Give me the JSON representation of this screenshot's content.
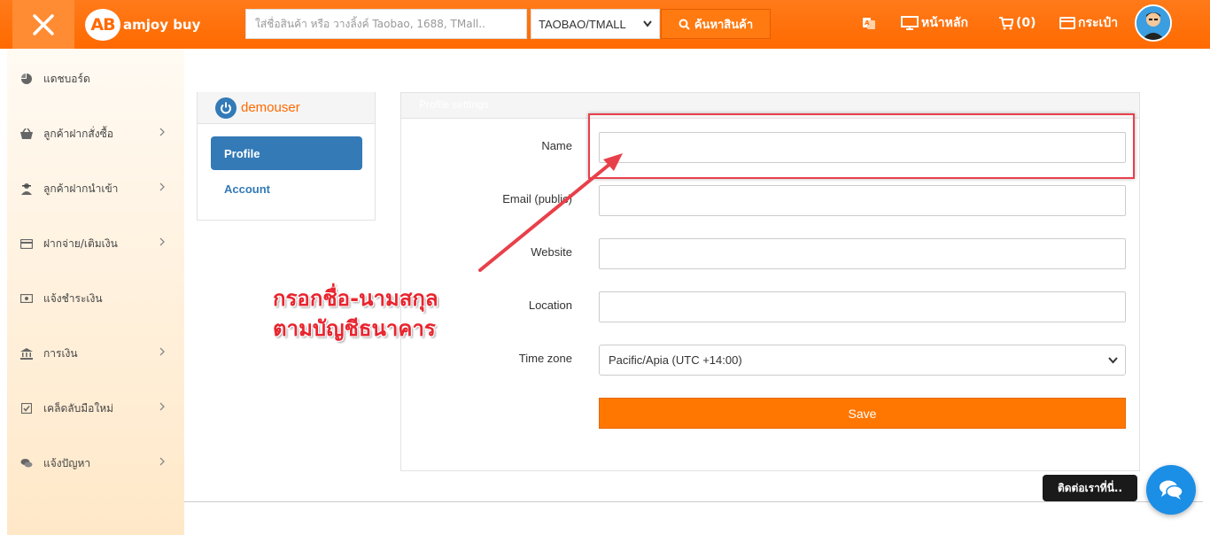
{
  "header": {
    "logo_badge": "AB",
    "logo_text": "amjoy buy",
    "search_placeholder": "ใส่ชื่อสินค้า หรือ วางลิ้งค์ Taobao, 1688, TMall..",
    "source_selected": "TAOBAO/TMALL",
    "search_button": "ค้นหาสินค้า",
    "nav_home": "หน้าหลัก",
    "nav_cart": "(0)",
    "nav_wallet": "กระเป๋า",
    "accent": "#ff6a00"
  },
  "sidebar": {
    "items": [
      {
        "label": "แดชบอร์ด",
        "icon": "pie-chart-icon"
      },
      {
        "label": "ลูกค้าฝากสั่งซื้อ",
        "icon": "basket-icon"
      },
      {
        "label": "ลูกค้าฝากนำเข้า",
        "icon": "agent-icon"
      },
      {
        "label": "ฝากจ่าย/เติมเงิน",
        "icon": "credit-card-icon"
      },
      {
        "label": "แจ้งชำระเงิน",
        "icon": "money-icon"
      },
      {
        "label": "การเงิน",
        "icon": "bank-icon"
      },
      {
        "label": "เคล็ดลับมือใหม่",
        "icon": "checkbox-icon"
      },
      {
        "label": "แจ้งปัญหา",
        "icon": "comments-icon"
      }
    ]
  },
  "user_card": {
    "username": "demouser",
    "tab_profile": "Profile",
    "tab_account": "Account"
  },
  "settings": {
    "title": "Profile settings",
    "name_label": "Name",
    "email_label": "Email (public)",
    "website_label": "Website",
    "location_label": "Location",
    "timezone_label": "Time zone",
    "timezone_value": "Pacific/Apia (UTC +14:00)",
    "save_label": "Save"
  },
  "annotation": {
    "line1": "กรอกชื่อ-นามสกุล",
    "line2": "ตามบัญชีธนาคาร"
  },
  "contact": {
    "tip": "ติดต่อเราที่นี่.."
  }
}
